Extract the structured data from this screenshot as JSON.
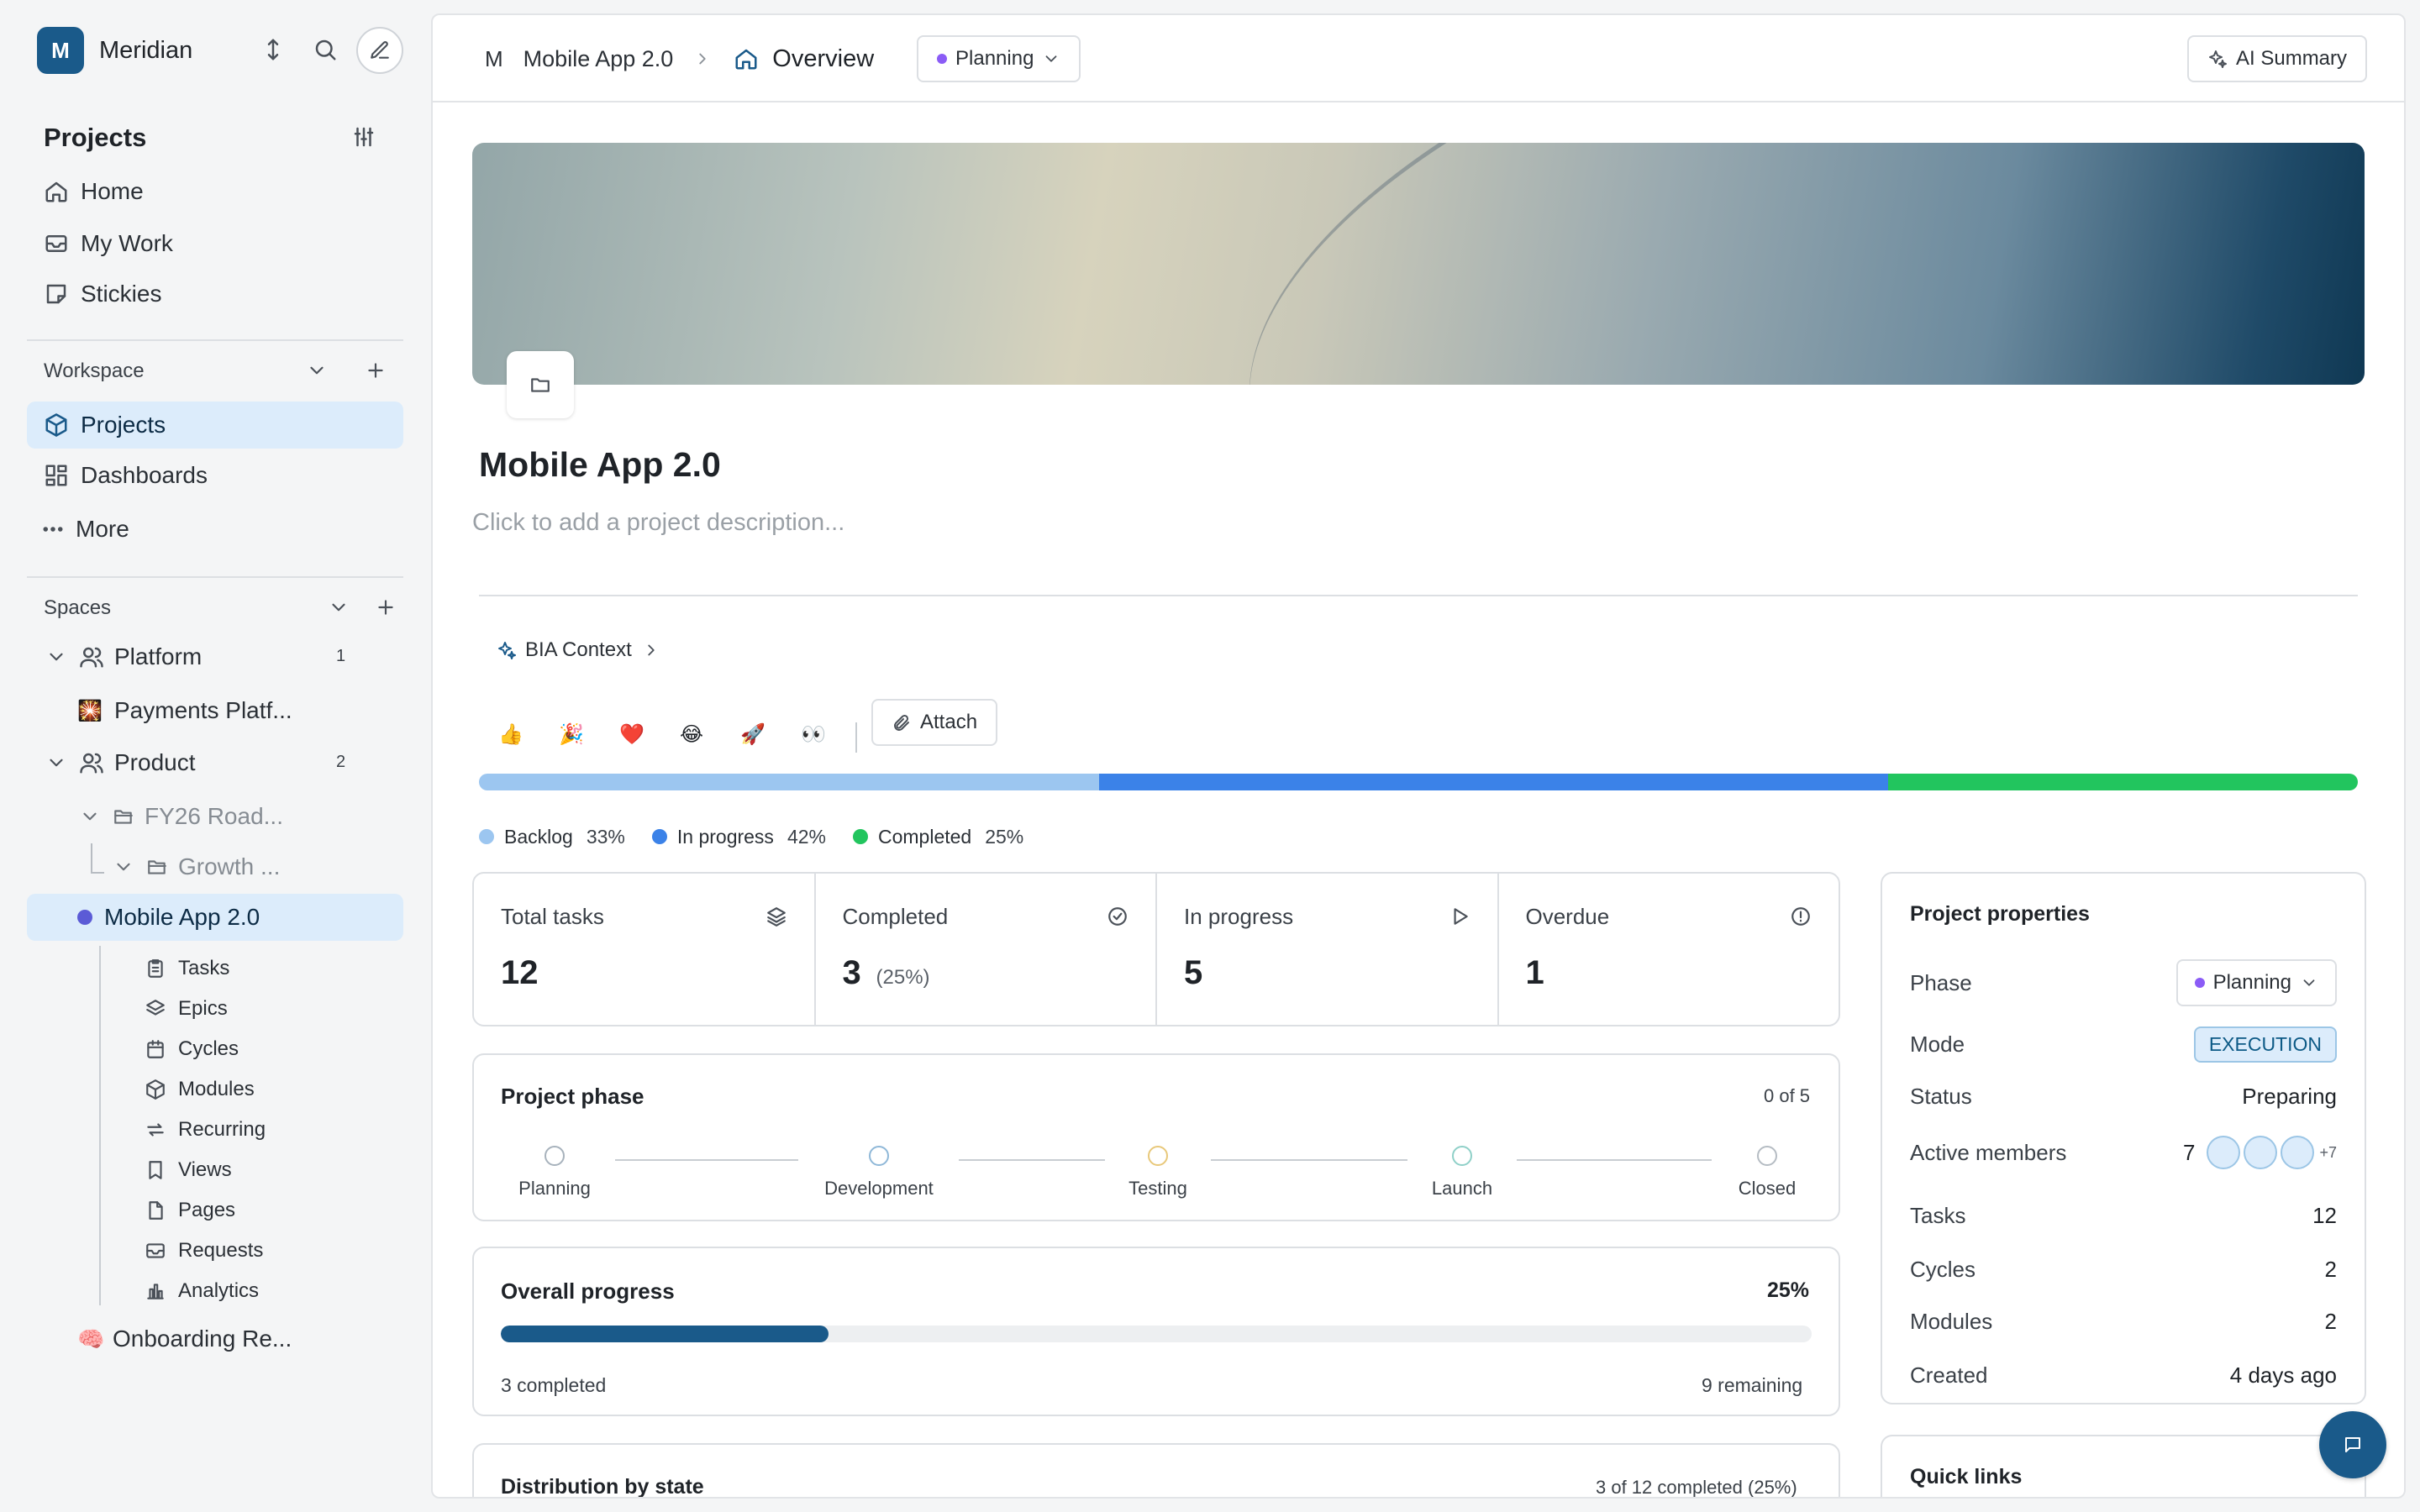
{
  "workspace": {
    "avatar_letter": "M",
    "name": "Meridian"
  },
  "sidebar": {
    "projects_title": "Projects",
    "top_items": [
      {
        "label": "Home",
        "icon": "home-icon"
      },
      {
        "label": "My Work",
        "icon": "inbox-icon"
      },
      {
        "label": "Stickies",
        "icon": "sticky-note-icon"
      }
    ],
    "workspace_section": "Workspace",
    "workspace_items": [
      {
        "label": "Projects",
        "icon": "cube-icon",
        "active": true
      },
      {
        "label": "Dashboards",
        "icon": "dashboard-icon"
      },
      {
        "label": "More",
        "icon": "more-icon"
      }
    ],
    "spaces_section": "Spaces",
    "spaces": {
      "platform": {
        "label": "Platform",
        "count": "1"
      },
      "payments": {
        "label": "Payments Platf...",
        "emoji": "🎇"
      },
      "product": {
        "label": "Product",
        "count": "2"
      },
      "fy26": {
        "label": "FY26 Road..."
      },
      "growth": {
        "label": "Growth ..."
      },
      "mobile": {
        "label": "Mobile App 2.0"
      },
      "onboarding": {
        "label": "Onboarding Re...",
        "emoji": "🧠"
      }
    },
    "project_items": [
      {
        "label": "Tasks"
      },
      {
        "label": "Epics"
      },
      {
        "label": "Cycles"
      },
      {
        "label": "Modules"
      },
      {
        "label": "Recurring"
      },
      {
        "label": "Views"
      },
      {
        "label": "Pages"
      },
      {
        "label": "Requests"
      },
      {
        "label": "Analytics"
      }
    ]
  },
  "header": {
    "project_letter": "M",
    "project_name": "Mobile App 2.0",
    "page": "Overview",
    "phase": "Planning",
    "ai_summary": "AI Summary"
  },
  "project": {
    "title": "Mobile App 2.0",
    "description_placeholder": "Click to add a project description...",
    "bia_context": "BIA Context",
    "reactions": [
      "👍",
      "🎉",
      "❤️",
      "😂",
      "🚀",
      "👀"
    ],
    "attach": "Attach"
  },
  "distribution": {
    "segments": [
      {
        "label": "Backlog",
        "pct_label": "33%",
        "value": 0.33,
        "color": "#9cc6f0"
      },
      {
        "label": "In progress",
        "pct_label": "42%",
        "value": 0.42,
        "color": "#3b82e8"
      },
      {
        "label": "Completed",
        "pct_label": "25%",
        "value": 0.25,
        "color": "#22c55e"
      }
    ]
  },
  "stats": [
    {
      "label": "Total tasks",
      "value": "12",
      "sub": "",
      "icon": "layers-icon"
    },
    {
      "label": "Completed",
      "value": "3",
      "sub": "(25%)",
      "icon": "check-circle-icon"
    },
    {
      "label": "In progress",
      "value": "5",
      "sub": "",
      "icon": "play-icon"
    },
    {
      "label": "Overdue",
      "value": "1",
      "sub": "",
      "icon": "alert-circle-icon"
    }
  ],
  "phase_card": {
    "title": "Project phase",
    "count": "0 of 5",
    "phases": [
      {
        "label": "Planning",
        "color": "#a7b2bc"
      },
      {
        "label": "Development",
        "color": "#8fb8d8"
      },
      {
        "label": "Testing",
        "color": "#e8c87a"
      },
      {
        "label": "Launch",
        "color": "#8fd0c8"
      },
      {
        "label": "Closed",
        "color": "#b5bcc3"
      }
    ]
  },
  "overall": {
    "title": "Overall progress",
    "pct_label": "25%",
    "value": 0.25,
    "completed": "3 completed",
    "remaining": "9 remaining"
  },
  "dist_card": {
    "title": "Distribution by state",
    "summary": "3 of 12 completed (25%)"
  },
  "properties": {
    "title": "Project properties",
    "phase_label": "Phase",
    "phase_value": "Planning",
    "mode_label": "Mode",
    "mode_value": "EXECUTION",
    "status_label": "Status",
    "status_value": "Preparing",
    "members_label": "Active members",
    "members_count": "7",
    "members_more": "+7",
    "tasks_label": "Tasks",
    "tasks_value": "12",
    "cycles_label": "Cycles",
    "cycles_value": "2",
    "modules_label": "Modules",
    "modules_value": "2",
    "created_label": "Created",
    "created_value": "4 days ago"
  },
  "quick_links": {
    "title": "Quick links"
  },
  "colors": {
    "accent": "#1a5a8a",
    "active_nav": "#dcecfb",
    "phase_dot": "#8b5cf6",
    "mobile_dot": "#5b5bd6"
  }
}
